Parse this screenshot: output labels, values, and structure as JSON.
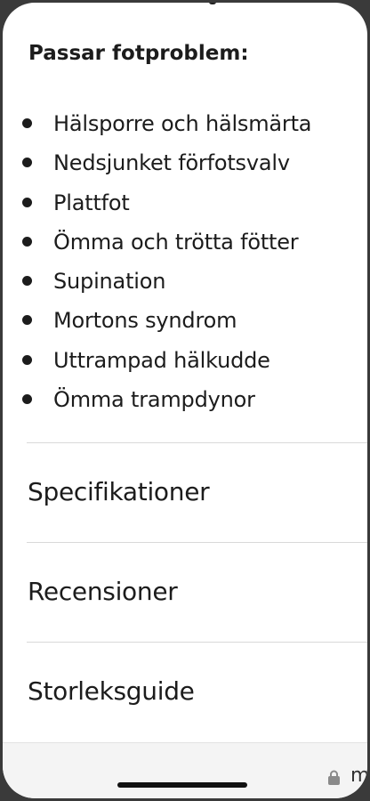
{
  "product_details": {
    "section_title": "Passar fotproblem:",
    "problems": [
      "Hälsporre och hälsmärta",
      "Nedsjunket förfotsvalv",
      "Plattfot",
      "Ömma och trötta fötter",
      "Supination",
      "Mortons syndrom",
      "Uttrampad hälkudde",
      "Ömma trampdynor"
    ]
  },
  "accordion": {
    "items": [
      {
        "label": "Specifikationer"
      },
      {
        "label": "Recensioner"
      },
      {
        "label": "Storleksguide"
      }
    ]
  },
  "browser_bar": {
    "url_fragment": "m",
    "lock_icon": "lock-icon"
  }
}
